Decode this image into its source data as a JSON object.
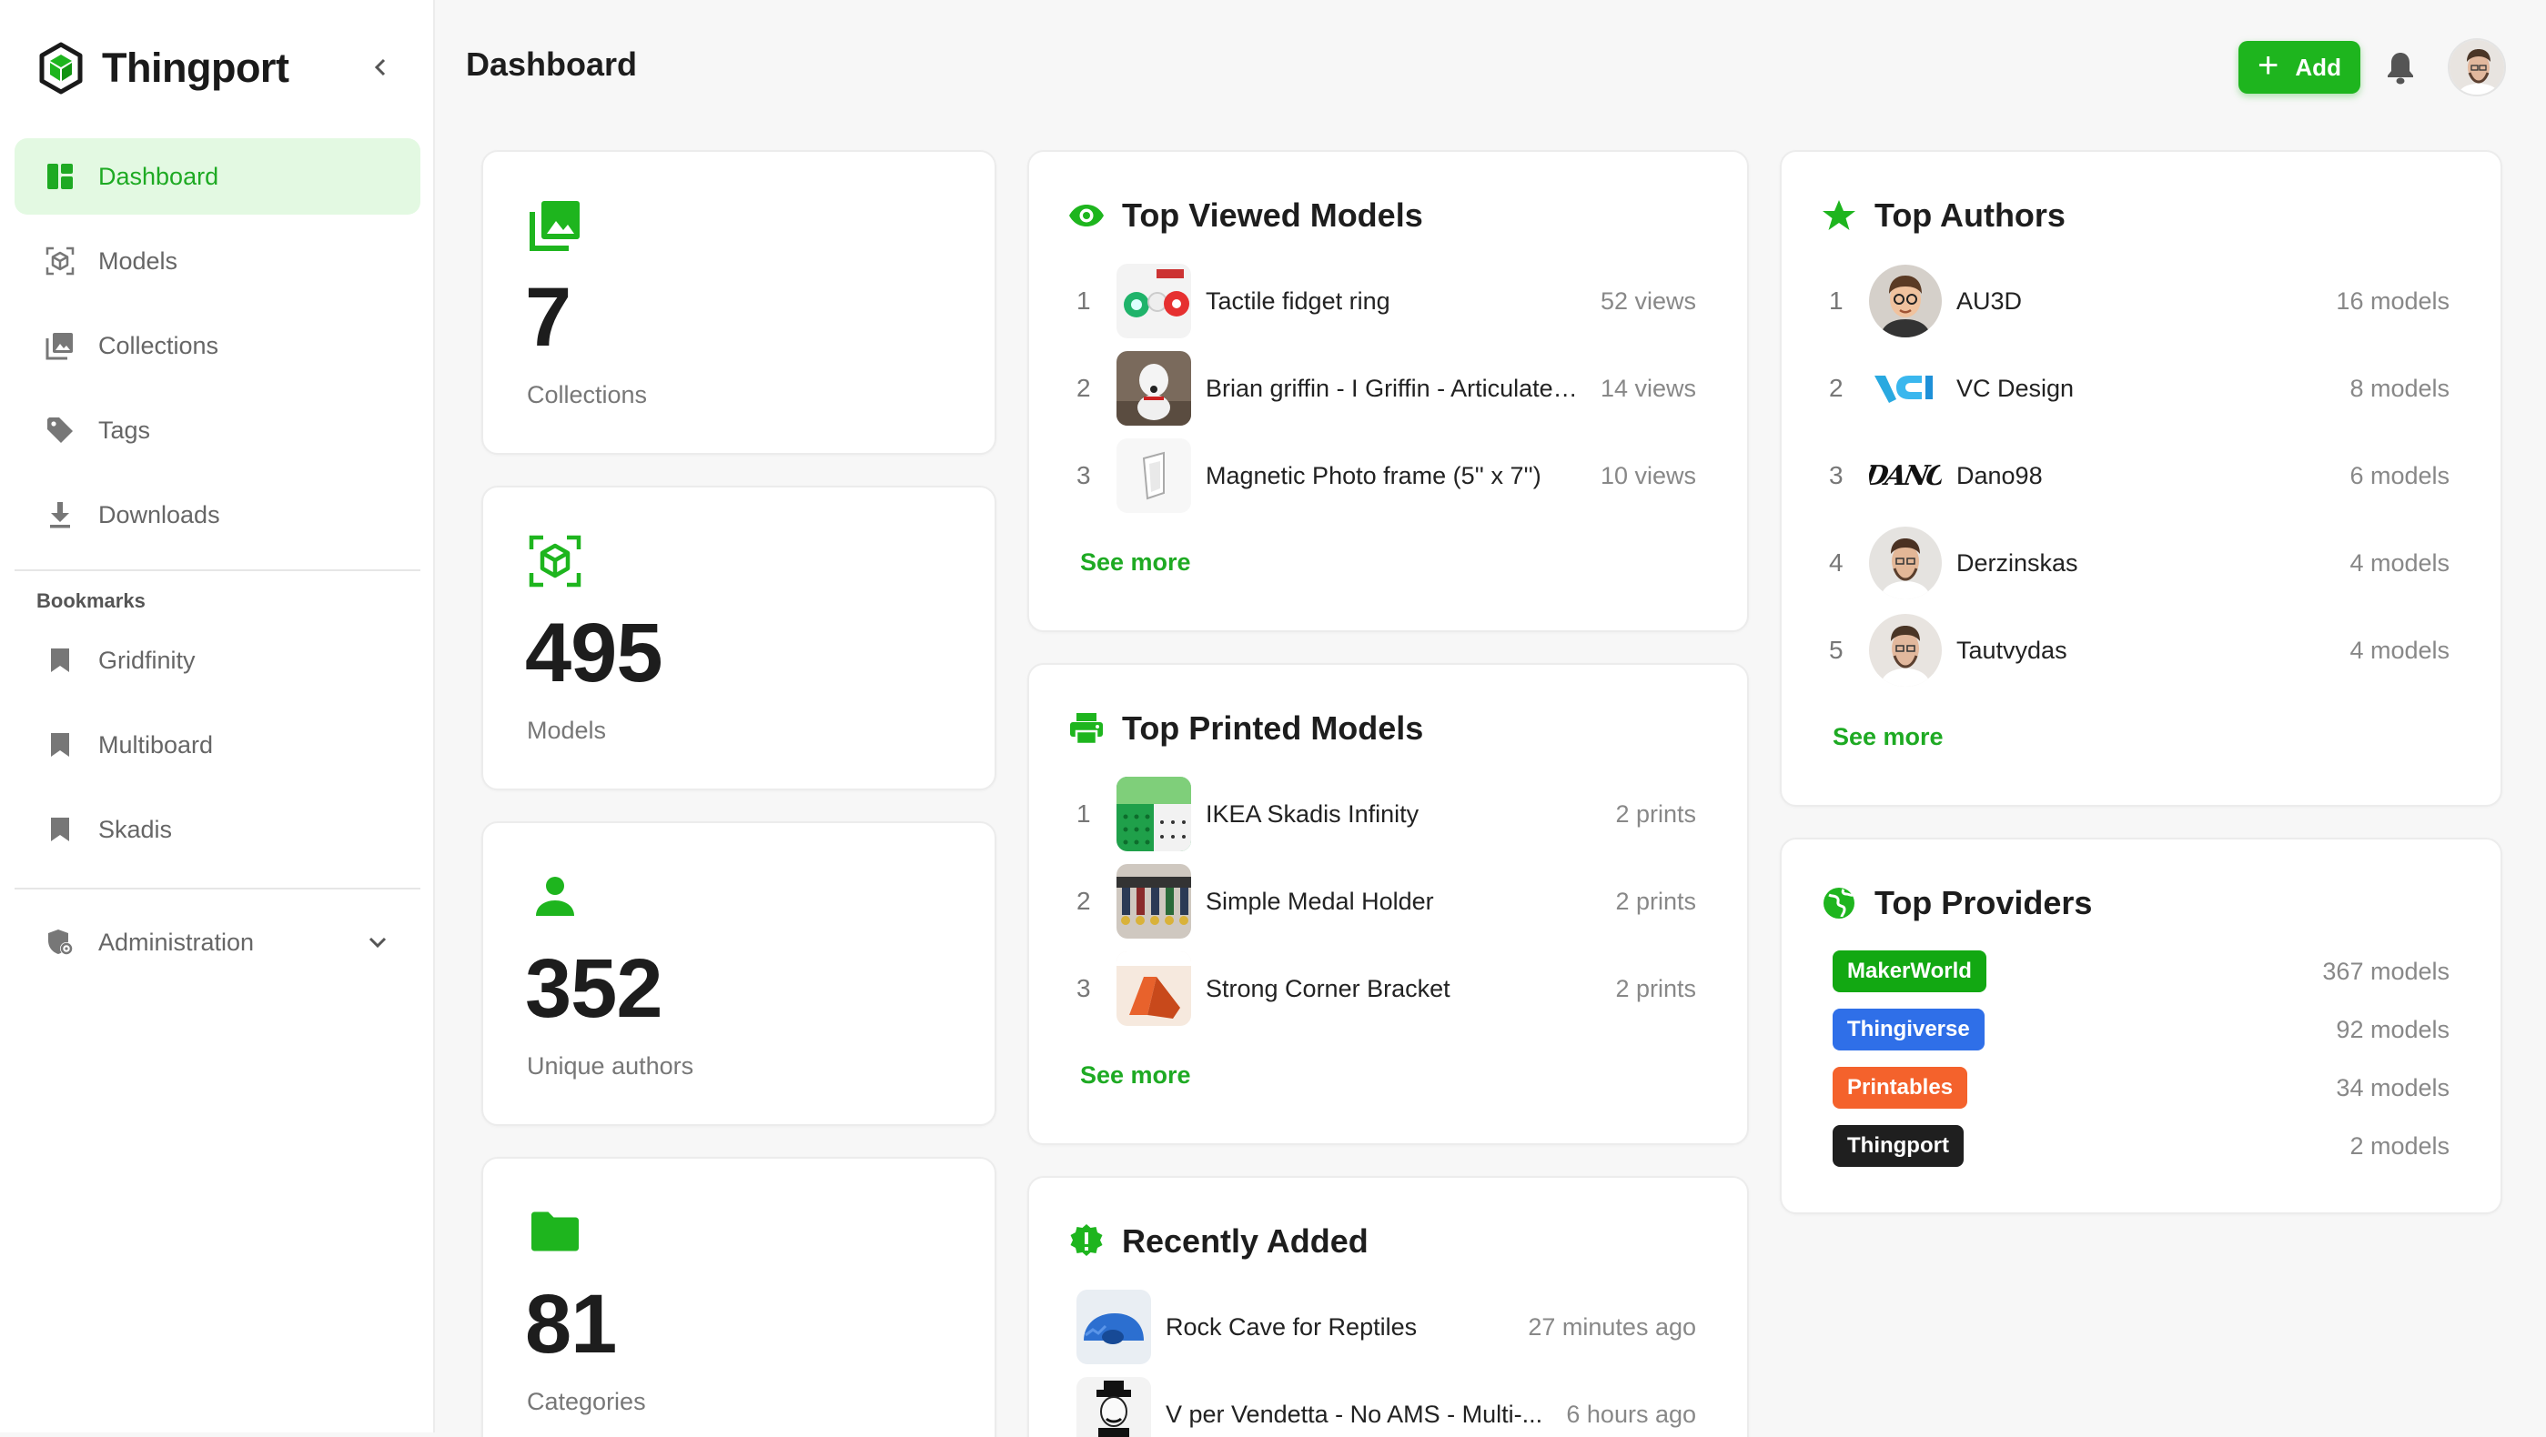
{
  "app": {
    "name": "Thingport"
  },
  "header": {
    "title": "Dashboard",
    "add_label": "Add"
  },
  "sidebar": {
    "items": [
      {
        "label": "Dashboard",
        "icon": "dashboard-icon",
        "active": true
      },
      {
        "label": "Models",
        "icon": "cube-icon"
      },
      {
        "label": "Collections",
        "icon": "images-icon"
      },
      {
        "label": "Tags",
        "icon": "tag-icon"
      },
      {
        "label": "Downloads",
        "icon": "download-icon"
      }
    ],
    "bookmarks_label": "Bookmarks",
    "bookmarks": [
      {
        "label": "Gridfinity",
        "icon": "bookmark-icon"
      },
      {
        "label": "Multiboard",
        "icon": "bookmark-icon"
      },
      {
        "label": "Skadis",
        "icon": "bookmark-icon"
      }
    ],
    "admin": {
      "label": "Administration",
      "icon": "shield-icon"
    }
  },
  "stats": [
    {
      "value": "7",
      "label": "Collections",
      "icon": "images-icon"
    },
    {
      "value": "495",
      "label": "Models",
      "icon": "cube-icon"
    },
    {
      "value": "352",
      "label": "Unique authors",
      "icon": "person-icon"
    },
    {
      "value": "81",
      "label": "Categories",
      "icon": "folder-icon"
    }
  ],
  "top_viewed": {
    "title": "Top Viewed Models",
    "items": [
      {
        "rank": "1",
        "name": "Tactile fidget ring",
        "meta": "52 views"
      },
      {
        "rank": "2",
        "name": "Brian griffin - I Griffin - Articulated...",
        "meta": "14 views"
      },
      {
        "rank": "3",
        "name": "Magnetic Photo frame (5'' x 7'')",
        "meta": "10 views"
      }
    ],
    "see_more": "See more"
  },
  "top_printed": {
    "title": "Top Printed Models",
    "items": [
      {
        "rank": "1",
        "name": "IKEA Skadis Infinity",
        "meta": "2 prints"
      },
      {
        "rank": "2",
        "name": "Simple Medal Holder",
        "meta": "2 prints"
      },
      {
        "rank": "3",
        "name": "Strong Corner Bracket",
        "meta": "2 prints"
      }
    ],
    "see_more": "See more"
  },
  "recently_added": {
    "title": "Recently Added",
    "items": [
      {
        "name": "Rock Cave for Reptiles",
        "meta": "27 minutes ago"
      },
      {
        "name": "V per Vendetta - No AMS - Multi-...",
        "meta": "6 hours ago"
      }
    ]
  },
  "top_authors": {
    "title": "Top Authors",
    "items": [
      {
        "rank": "1",
        "name": "AU3D",
        "meta": "16 models"
      },
      {
        "rank": "2",
        "name": "VC Design",
        "meta": "8 models"
      },
      {
        "rank": "3",
        "name": "Dano98",
        "meta": "6 models"
      },
      {
        "rank": "4",
        "name": "Derzinskas",
        "meta": "4 models"
      },
      {
        "rank": "5",
        "name": "Tautvydas",
        "meta": "4 models"
      }
    ],
    "logo_text": "DANO",
    "see_more": "See more"
  },
  "top_providers": {
    "title": "Top Providers",
    "items": [
      {
        "name": "MakerWorld",
        "meta": "367 models",
        "color": "#12a812"
      },
      {
        "name": "Thingiverse",
        "meta": "92 models",
        "color": "#2f6fe8"
      },
      {
        "name": "Printables",
        "meta": "34 models",
        "color": "#f4622c"
      },
      {
        "name": "Thingport",
        "meta": "2 models",
        "color": "#1f1f1f"
      }
    ]
  },
  "colors": {
    "accent": "#1eb51e",
    "accent_text": "#1eaa23",
    "active_bg": "#e3f9e2"
  }
}
